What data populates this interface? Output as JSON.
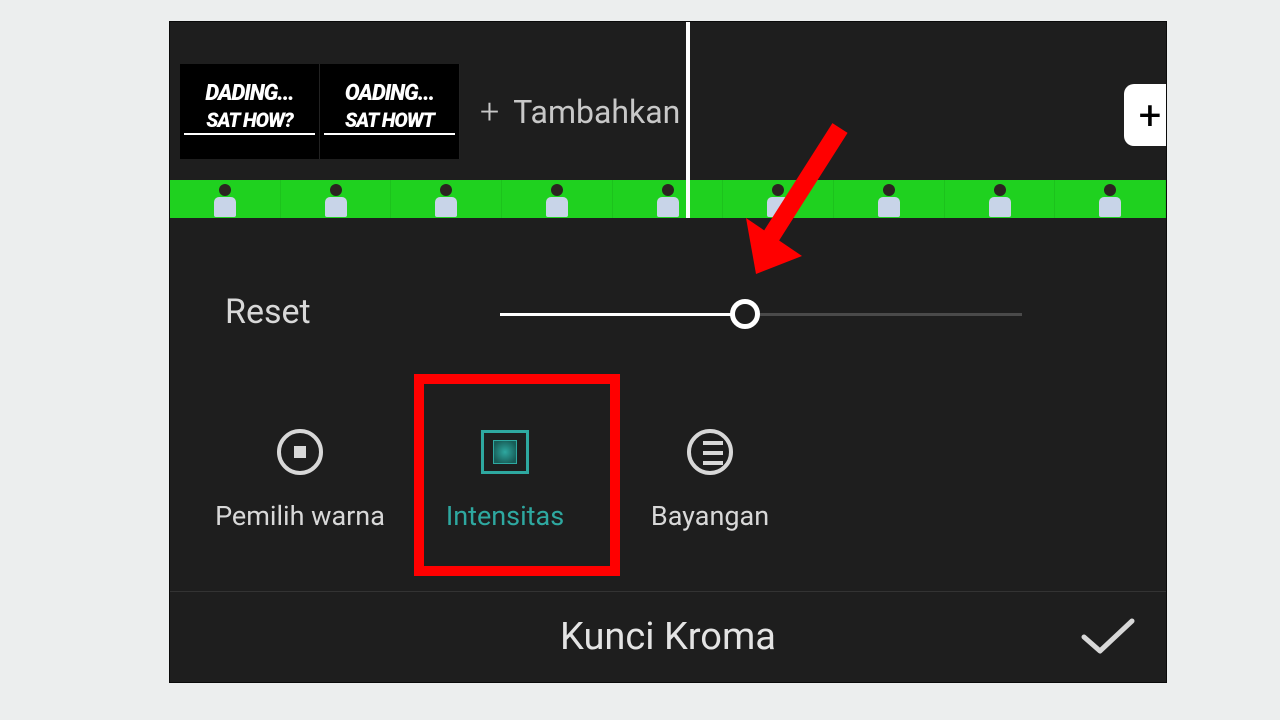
{
  "toprow": {
    "thumb_line1": "DADING...",
    "thumb_line2": "SAT HOW?",
    "thumb2_line1": "OADING...",
    "thumb2_line2": "SAT HOWT",
    "add_label": "Tambahkan"
  },
  "slider": {
    "reset_label": "Reset",
    "value_pct": 47
  },
  "tools": {
    "picker_label": "Pemilih warna",
    "intensity_label": "Intensitas",
    "shadow_label": "Bayangan"
  },
  "bottom": {
    "title": "Kunci Kroma"
  }
}
